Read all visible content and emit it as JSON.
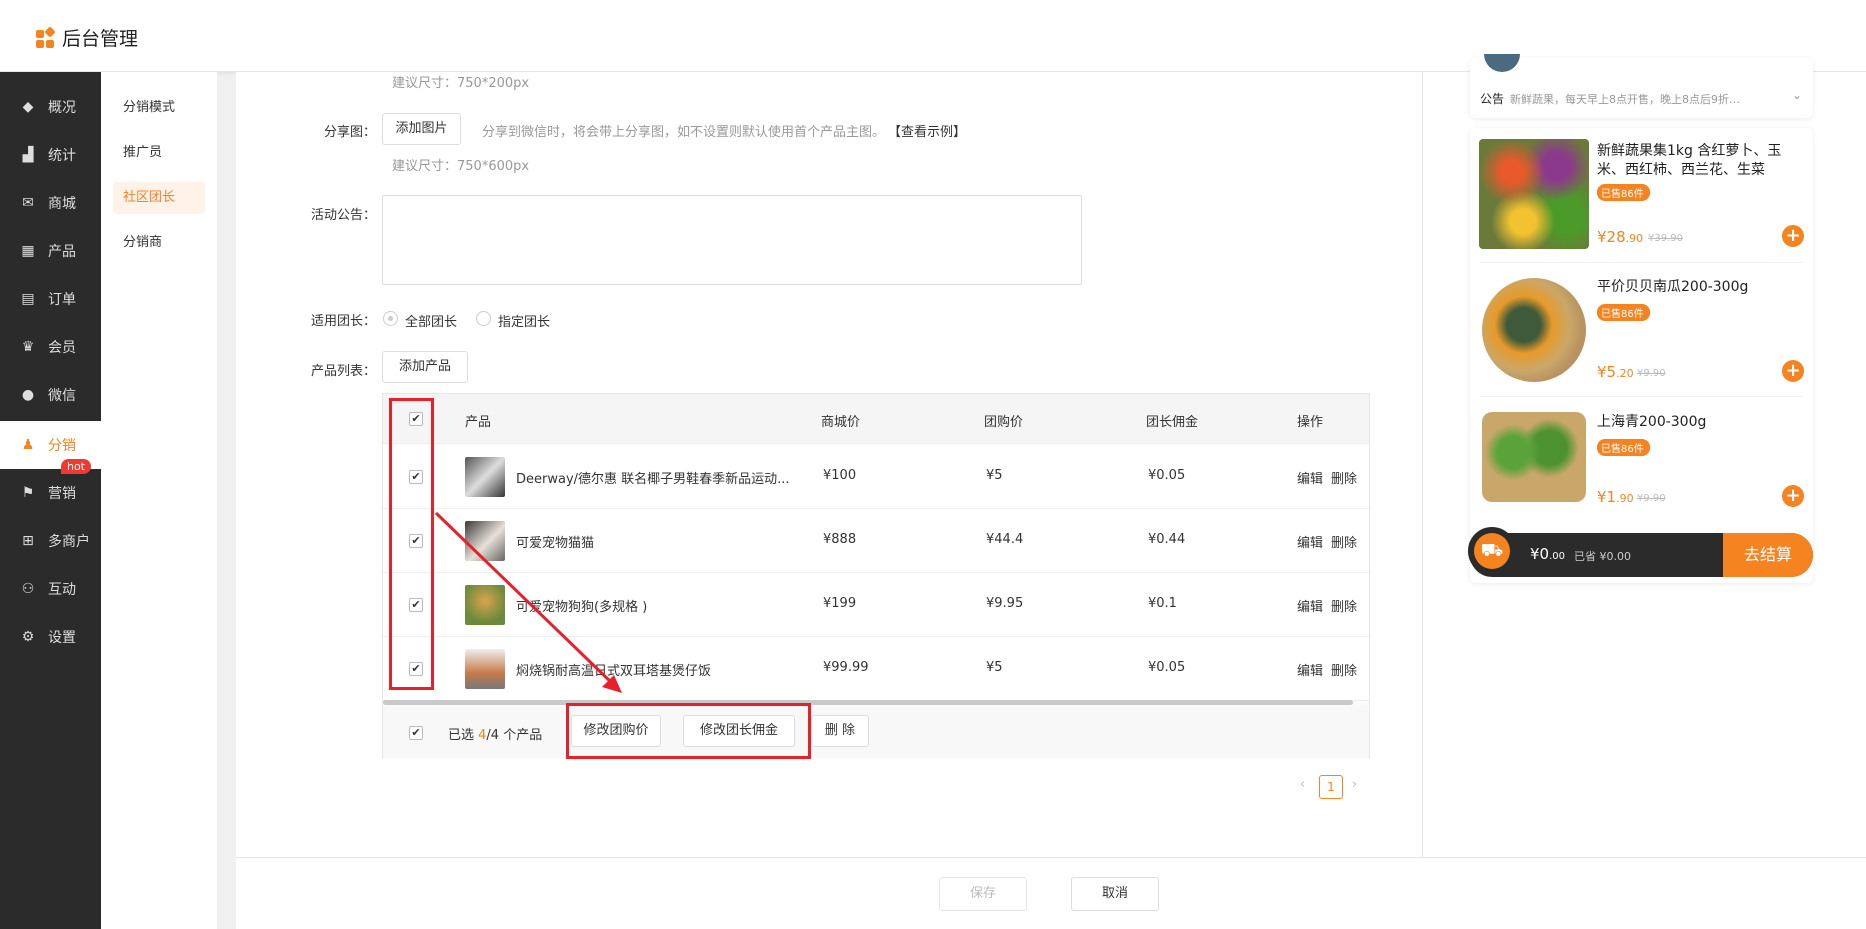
{
  "app": {
    "title": "后台管理"
  },
  "sidebar": {
    "items": [
      {
        "label": "概况",
        "icon": "layers-icon"
      },
      {
        "label": "统计",
        "icon": "chart-icon"
      },
      {
        "label": "商城",
        "icon": "mail-icon"
      },
      {
        "label": "产品",
        "icon": "grid-icon"
      },
      {
        "label": "订单",
        "icon": "clipboard-icon"
      },
      {
        "label": "会员",
        "icon": "crown-icon"
      },
      {
        "label": "微信",
        "icon": "wechat-icon"
      },
      {
        "label": "分销",
        "icon": "users-icon"
      },
      {
        "label": "营销",
        "icon": "flag-icon",
        "badge": "hot"
      },
      {
        "label": "多商户",
        "icon": "store-icon"
      },
      {
        "label": "互动",
        "icon": "people-icon"
      },
      {
        "label": "设置",
        "icon": "gear-icon"
      }
    ]
  },
  "subnav": {
    "items": [
      "分销模式",
      "推广员",
      "社区团长",
      "分销商"
    ]
  },
  "form": {
    "size_hint_top": "建议尺寸：750*200px",
    "share_label": "分享图：",
    "add_image": "添加图片",
    "share_hint": "分享到微信时，将会带上分享图，如不设置则默认使用首个产品主图。",
    "view_example": "【查看示例】",
    "size_hint_share": "建议尺寸：750*600px",
    "notice_label": "活动公告：",
    "leader_label": "适用团长：",
    "leader_all": "全部团长",
    "leader_specific": "指定团长",
    "product_list_label": "产品列表：",
    "add_product": "添加产品"
  },
  "table": {
    "headers": [
      "产品",
      "商城价",
      "团购价",
      "团长佣金",
      "操作"
    ],
    "rows": [
      {
        "name": "Deerway/德尔惠 联名椰子男鞋春季新品运动...",
        "mall_price": "¥100",
        "group_price": "¥5",
        "commission": "¥0.05"
      },
      {
        "name": "可爱宠物猫猫",
        "mall_price": "¥888",
        "group_price": "¥44.4",
        "commission": "¥0.44"
      },
      {
        "name": "可爱宠物狗狗(多规格 )",
        "mall_price": "¥199",
        "group_price": "¥9.95",
        "commission": "¥0.1"
      },
      {
        "name": "焖烧锅耐高温日式双耳塔基煲仔饭",
        "mall_price": "¥99.99",
        "group_price": "¥5",
        "commission": "¥0.05"
      }
    ],
    "edit": "编辑",
    "delete": "删除",
    "selected_prefix": "已选 ",
    "selected_count": "4",
    "selected_suffix": "/4 个产品",
    "btn_group_price": "修改团购价",
    "btn_commission": "修改团长佣金",
    "btn_delete": "删 除"
  },
  "pager": {
    "current": "1",
    "prev": "‹",
    "next": "›"
  },
  "actions": {
    "save": "保存",
    "cancel": "取消"
  },
  "preview": {
    "notice_label": "公告",
    "notice_text": "新鲜蔬果，每天早上8点开售，晚上8点后9折…",
    "products": [
      {
        "title": "新鲜蔬果集1kg 含红萝卜、玉米、西红柿、西兰花、生菜",
        "sold": "已售86件",
        "price_int": "¥28",
        "price_dec": ".90",
        "old": "¥39.90"
      },
      {
        "title": "平价贝贝南瓜200-300g",
        "sold": "已售86件",
        "price_int": "¥5",
        "price_dec": ".20",
        "old": "¥9.90"
      },
      {
        "title": "上海青200-300g",
        "sold": "已售86件",
        "price_int": "¥1",
        "price_dec": ".90",
        "old": "¥9.90"
      }
    ],
    "cart_total_int": "¥0",
    "cart_total_dec": ".00",
    "cart_saved": "已省 ¥0.00",
    "checkout": "去结算"
  },
  "colors": {
    "accent": "#f5831f",
    "highlight": "#e8202a",
    "sidebar": "#2b2b2b"
  }
}
